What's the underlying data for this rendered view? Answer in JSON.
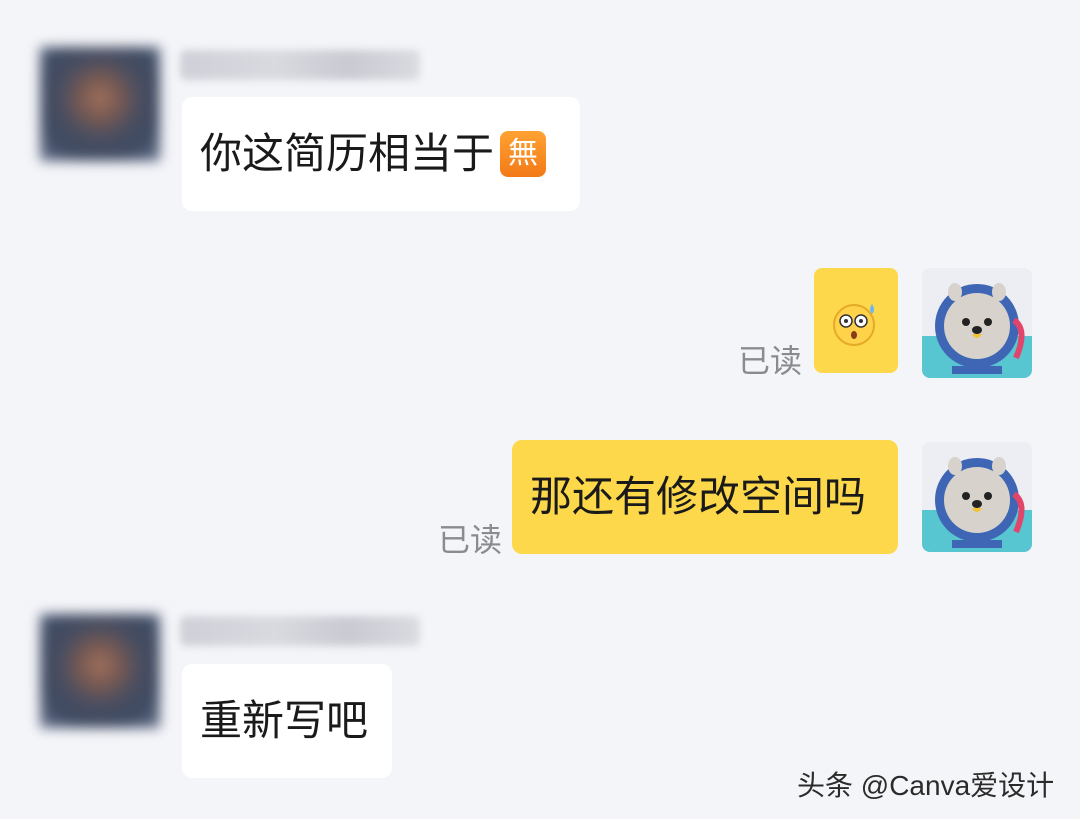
{
  "messages": [
    {
      "side": "left",
      "text": "你这简历相当于",
      "emoji": "無"
    },
    {
      "side": "right",
      "sticker": "worried-face-sticker",
      "status": "已读"
    },
    {
      "side": "right",
      "text": "那还有修改空间吗",
      "status": "已读"
    },
    {
      "side": "left",
      "text": "重新写吧"
    }
  ],
  "watermark": "头条 @Canva爱设计",
  "colors": {
    "background": "#f4f5f9",
    "own_bubble": "#fdd84a",
    "other_bubble": "#ffffff",
    "read_status": "#8a8b90"
  },
  "icons": {
    "avatar_self": "seal-mascot-avatar",
    "avatar_other": "blurred-avatar"
  }
}
